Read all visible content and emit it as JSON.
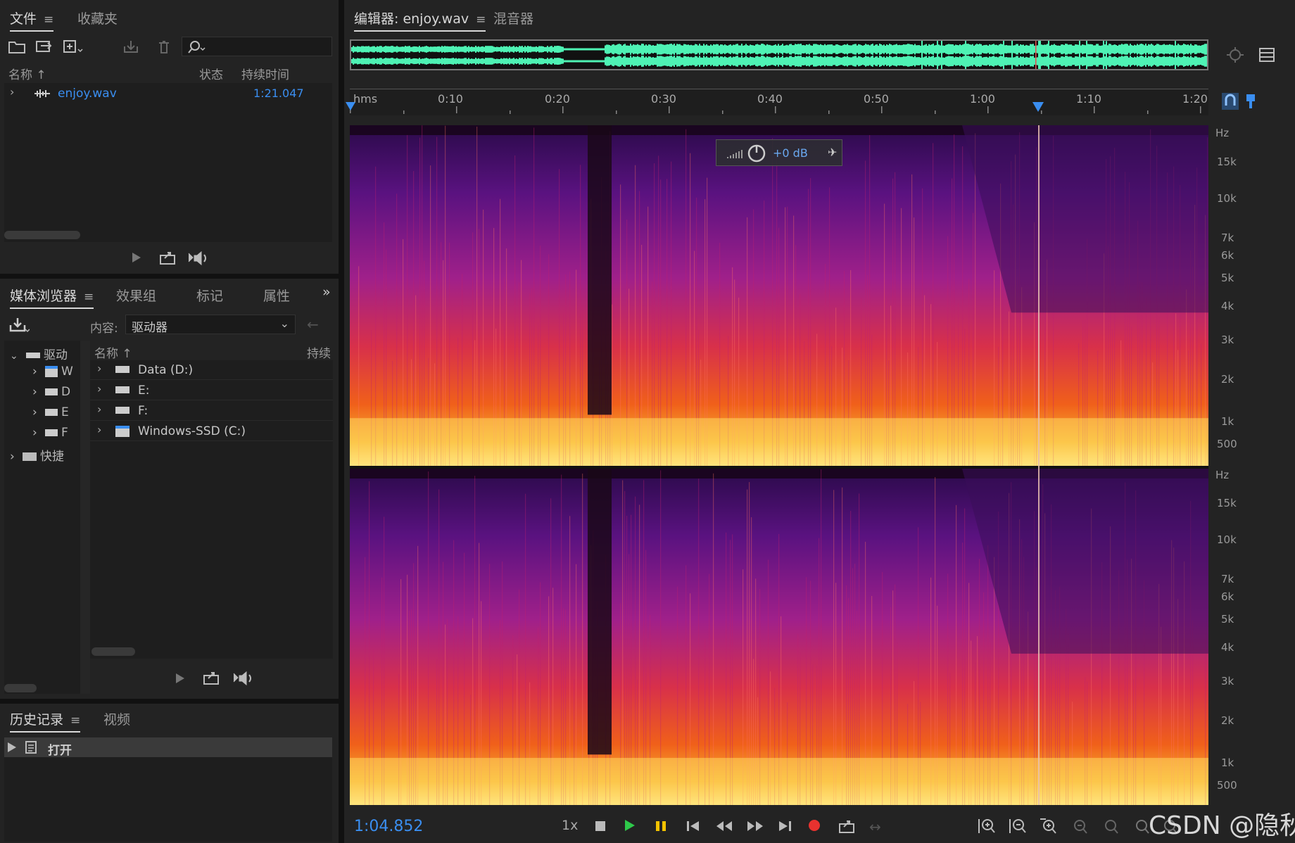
{
  "files_panel": {
    "tabs": [
      "文件",
      "收藏夹"
    ],
    "col_name": "名称",
    "col_status": "状态",
    "col_duration": "持续时间",
    "file": {
      "name": "enjoy.wav",
      "duration": "1:21.047"
    }
  },
  "media_panel": {
    "tabs": [
      "媒体浏览器",
      "效果组",
      "标记",
      "属性"
    ],
    "content_label": "内容:",
    "content_value": "驱动器",
    "tree_root": "驱动",
    "tree_quick": "快捷",
    "tree_children": [
      "W",
      "D",
      "E",
      "F"
    ],
    "col_name": "名称",
    "col_duration": "持续",
    "drives": [
      "Data (D:)",
      "E:",
      "F:",
      "Windows-SSD (C:)"
    ]
  },
  "history_panel": {
    "tabs": [
      "历史记录",
      "视频"
    ],
    "items": [
      "打开"
    ]
  },
  "editor": {
    "tabs": [
      "编辑器: enjoy.wav",
      "混音器"
    ],
    "ruler_unit": "hms",
    "ruler_ticks": [
      "0:10",
      "0:20",
      "0:30",
      "0:40",
      "0:50",
      "1:00",
      "1:10",
      "1:20"
    ],
    "hz_labels": [
      "Hz",
      "15k",
      "10k",
      "7k",
      "6k",
      "5k",
      "4k",
      "3k",
      "2k",
      "1k",
      "500"
    ],
    "gain_value": "+0 dB",
    "current_time": "1:04.852",
    "playback_rate": "1x",
    "playhead_fraction": 0.799
  },
  "watermark": "CSDN @隐秋",
  "icons": [
    "folder-open-icon",
    "import-icon",
    "new-file-icon",
    "save-icon",
    "trash-icon",
    "search-icon",
    "play-icon",
    "export-icon",
    "volume-icon",
    "stop-icon",
    "pause-icon",
    "record-icon",
    "zoom-icon",
    "settings-icon"
  ],
  "colors": {
    "accent_blue": "#3a8ef0",
    "waveform": "#4ef2b4",
    "playhead": "#e8c0b0"
  }
}
